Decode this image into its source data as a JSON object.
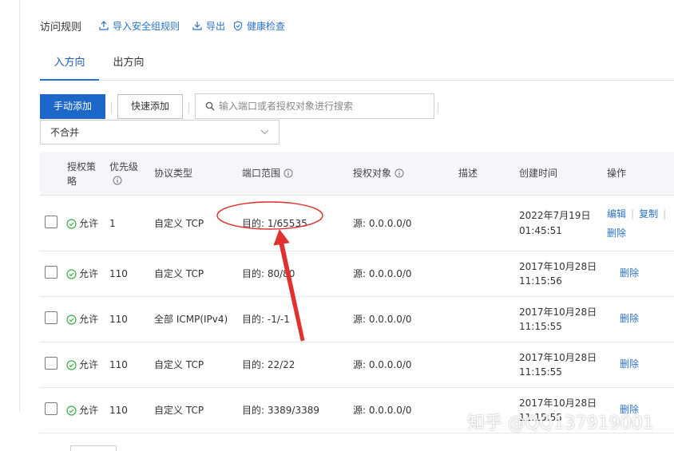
{
  "header": {
    "title": "访问规则",
    "links": [
      {
        "label": "导入安全组规则",
        "icon": "upload-icon"
      },
      {
        "label": "导出",
        "icon": "download-icon"
      },
      {
        "label": "健康检查",
        "icon": "shield-check-icon"
      }
    ]
  },
  "tabs": [
    {
      "label": "入方向",
      "active": true
    },
    {
      "label": "出方向",
      "active": false
    }
  ],
  "toolbar": {
    "manual_add": "手动添加",
    "quick_add": "快速添加",
    "search_placeholder": "输入端口或者授权对象进行搜索",
    "merge_select": "不合并"
  },
  "table": {
    "columns": {
      "policy": "授权策略",
      "priority": "优先级",
      "protocol": "协议类型",
      "port_range": "端口范围",
      "auth_object": "授权对象",
      "description": "描述",
      "created": "创建时间",
      "actions": "操作"
    },
    "rows": [
      {
        "policy": "允许",
        "priority": "1",
        "protocol": "自定义 TCP",
        "port": "目的: 1/65535",
        "source": "源: 0.0.0.0/0",
        "date": "2022年7月19日",
        "time": "01:45:51",
        "actions": [
          "编辑",
          "复制",
          "删除"
        ]
      },
      {
        "policy": "允许",
        "priority": "110",
        "protocol": "自定义 TCP",
        "port": "目的: 80/80",
        "source": "源: 0.0.0.0/0",
        "date": "2017年10月28日",
        "time": "11:15:56",
        "actions": [
          "删除"
        ]
      },
      {
        "policy": "允许",
        "priority": "110",
        "protocol": "全部 ICMP(IPv4)",
        "port": "目的: -1/-1",
        "source": "源: 0.0.0.0/0",
        "date": "2017年10月28日",
        "time": "11:15:55",
        "actions": [
          "删除"
        ]
      },
      {
        "policy": "允许",
        "priority": "110",
        "protocol": "自定义 TCP",
        "port": "目的: 22/22",
        "source": "源: 0.0.0.0/0",
        "date": "2017年10月28日",
        "time": "11:15:55",
        "actions": [
          "删除"
        ]
      },
      {
        "policy": "允许",
        "priority": "110",
        "protocol": "自定义 TCP",
        "port": "目的: 3389/3389",
        "source": "源: 0.0.0.0/0",
        "date": "2017年10月28日",
        "time": "11:15:55",
        "actions": [
          "删除"
        ]
      }
    ]
  },
  "watermark": "知乎 @QQ137919001",
  "colors": {
    "accent": "#1d67c9",
    "link": "#2b73c6",
    "allow_green": "#3dab4a",
    "annotation_red": "#e0312f"
  }
}
